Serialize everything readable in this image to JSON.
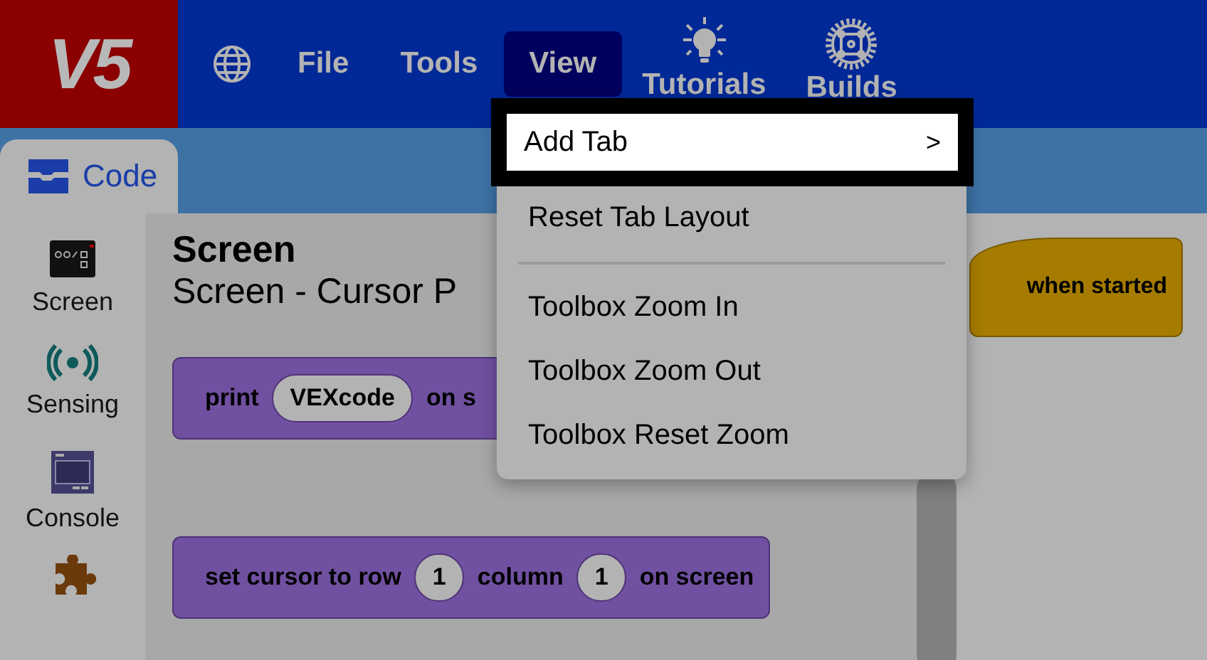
{
  "logo": "V5",
  "menubar": [
    {
      "kind": "globe",
      "selected": false
    },
    {
      "kind": "text",
      "label": "File",
      "selected": false
    },
    {
      "kind": "text",
      "label": "Tools",
      "selected": false
    },
    {
      "kind": "text",
      "label": "View",
      "selected": true
    },
    {
      "kind": "bulb",
      "label": "Tutorials",
      "selected": false
    },
    {
      "kind": "gear",
      "label": "Builds",
      "selected": false
    }
  ],
  "tabs": [
    {
      "label": "Code",
      "selected": true
    }
  ],
  "categories": [
    {
      "kind": "screen",
      "label": "Screen"
    },
    {
      "kind": "sensing",
      "label": "Sensing"
    },
    {
      "kind": "console",
      "label": "Console"
    },
    {
      "kind": "puzzle"
    }
  ],
  "palette": {
    "title": "Screen",
    "subtitle": "Screen - Cursor P",
    "blocks": [
      [
        {
          "kind": "text",
          "text": "print"
        },
        {
          "kind": "input",
          "text": "VEXcode"
        },
        {
          "kind": "text",
          "text": "on s"
        }
      ],
      [
        {
          "kind": "text",
          "text": "set cursor to row"
        },
        {
          "kind": "input",
          "text": "1"
        },
        {
          "kind": "text",
          "text": "column"
        },
        {
          "kind": "input",
          "text": "1"
        },
        {
          "kind": "text",
          "text": "on screen"
        }
      ]
    ]
  },
  "workspace": {
    "hat_block": "when started"
  },
  "view_menu": [
    {
      "kind": "item",
      "label": "Add Tab",
      "submenu": ">",
      "selected": true
    },
    {
      "kind": "item",
      "label": "Reset Tab Layout",
      "selected": false
    },
    {
      "kind": "divider"
    },
    {
      "kind": "item",
      "label": "Toolbox Zoom In",
      "selected": false
    },
    {
      "kind": "item",
      "label": "Toolbox Zoom Out",
      "selected": false
    },
    {
      "kind": "item",
      "label": "Toolbox Reset Zoom",
      "selected": false
    }
  ]
}
